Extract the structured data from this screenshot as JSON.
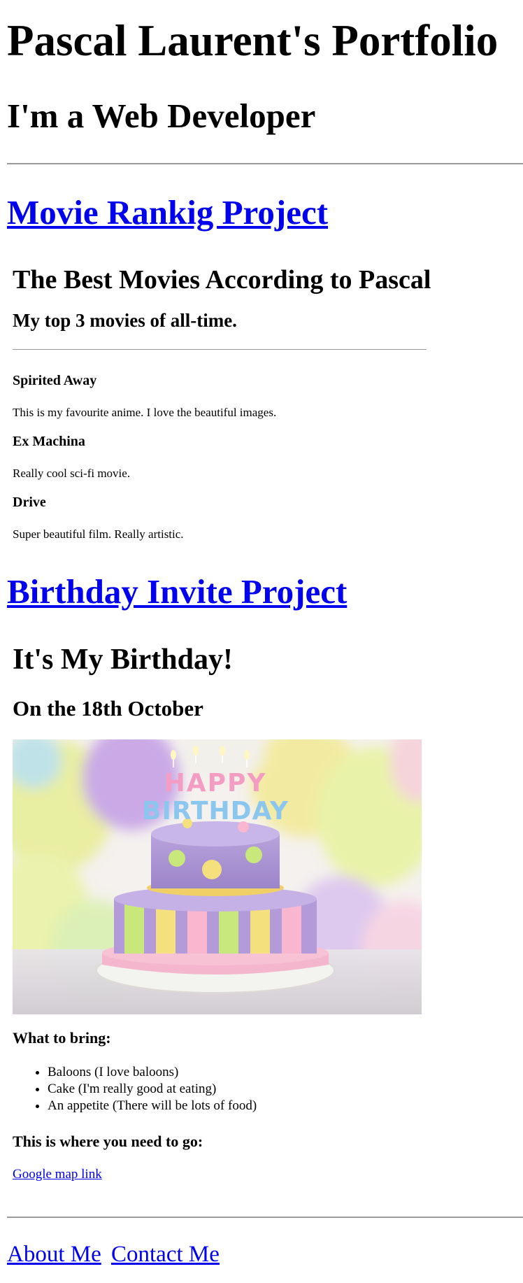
{
  "header": {
    "title": "Pascal Laurent's Portfolio",
    "subtitle": "I'm a Web Developer"
  },
  "projects": {
    "movie": {
      "link_label": "Movie Rankig Project",
      "heading": "The Best Movies According to Pascal",
      "subheading": "My top 3 movies of all-time.",
      "items": [
        {
          "title": "Spirited Away",
          "text": "This is my favourite anime. I love the beautiful images."
        },
        {
          "title": "Ex Machina",
          "text": "Really cool sci-fi movie."
        },
        {
          "title": "Drive",
          "text": "Super beautiful film. Really artistic."
        }
      ]
    },
    "birthday": {
      "link_label": "Birthday Invite Project",
      "heading": "It's My Birthday!",
      "subheading": "On the 18th October",
      "image_text": "HAPPY BIRTHDAY",
      "bring_title": "What to bring:",
      "bring_items": [
        "Baloons (I love baloons)",
        "Cake (I'm really good at eating)",
        "An appetite (There will be lots of food)"
      ],
      "where_title": "This is where you need to go:",
      "map_link_label": "Google map link"
    }
  },
  "footer": {
    "about_label": "About Me",
    "contact_label": "Contact Me"
  },
  "colors": {
    "link": "#0000ee",
    "text": "#000000",
    "rule": "#9a9a9a"
  }
}
